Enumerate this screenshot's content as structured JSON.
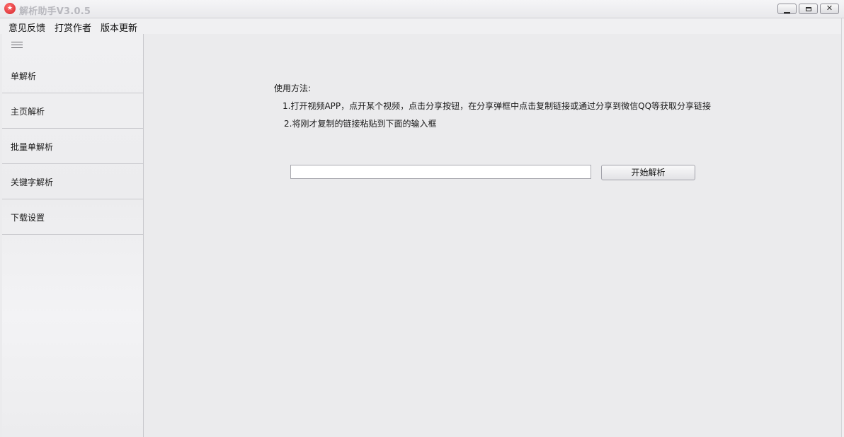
{
  "window": {
    "title": "解析助手V3.0.5",
    "icon": "app-logo-icon",
    "controls": {
      "minimize": "minimize-icon",
      "maximize": "maximize-icon",
      "close_glyph": "✕"
    }
  },
  "menubar": {
    "items": [
      {
        "label": "意见反馈"
      },
      {
        "label": "打赏作者"
      },
      {
        "label": "版本更新"
      }
    ]
  },
  "sidebar": {
    "menu_icon": "hamburger-icon",
    "items": [
      {
        "label": "单解析"
      },
      {
        "label": "主页解析"
      },
      {
        "label": "批量单解析"
      },
      {
        "label": "关键字解析"
      },
      {
        "label": "下载设置"
      }
    ]
  },
  "main": {
    "usage_title": "使用方法:",
    "steps": [
      "1.打开视频APP，点开某个视频，点击分享按钮，在分享弹框中点击复制链接或通过分享到微信QQ等获取分享链接",
      "2.将刚才复制的链接粘贴到下面的输入框"
    ],
    "url_input": {
      "value": "",
      "placeholder": ""
    },
    "start_button": "开始解析"
  },
  "colors": {
    "background": "#ebebed",
    "sidebar_border": "#c8c8cc",
    "title_text": "#b8b8be",
    "app_icon": "#d4262c"
  }
}
